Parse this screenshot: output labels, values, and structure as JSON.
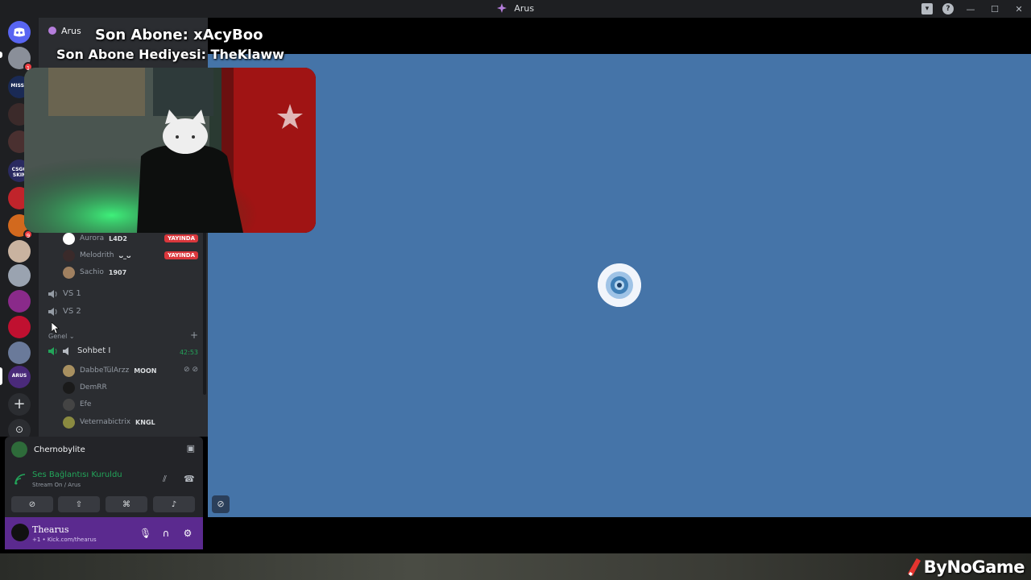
{
  "window": {
    "title": "Arus"
  },
  "overlay": {
    "last_sub": "Son Abone: xAcyBoo",
    "last_gift": "Son Abone Hediyesi: TheKlaww"
  },
  "sidebar": {
    "server_name": "Arus",
    "members_live": [
      {
        "name": "Aurora",
        "tag": "L4D2",
        "live": "YAYINDA"
      },
      {
        "name": "Melodrith",
        "tag": "ᴗ_ᴗ",
        "live": "YAYINDA"
      },
      {
        "name": "Sachio",
        "tag": "1907",
        "live": ""
      }
    ],
    "voice_channels": [
      {
        "name": "VS 1"
      },
      {
        "name": "VS 2"
      }
    ],
    "category": "Genel",
    "active_channel": {
      "name": "Sohbet I",
      "timer": "42:53"
    },
    "members": [
      {
        "name": "DabbeTülArzz",
        "tag": "MOON"
      },
      {
        "name": "DemRR",
        "tag": ""
      },
      {
        "name": "Efe",
        "tag": ""
      },
      {
        "name": "Veternabictrix",
        "tag": "KNGL"
      }
    ]
  },
  "voice_panel": {
    "activity": "Chernobylite",
    "status": "Ses Bağlantısı Kuruldu",
    "sub": "Stream On / Arus"
  },
  "user_panel": {
    "name": "Thearus",
    "sub": "+1 • Kick.com/thearus"
  },
  "servers": [
    {
      "badge": "1"
    },
    {
      "badge": ""
    },
    {
      "badge": ""
    },
    {
      "badge": ""
    },
    {
      "badge": ""
    },
    {
      "badge": ""
    },
    {
      "badge": "9"
    }
  ],
  "server_labels": {
    "missa": "MISSA",
    "csgo": "CSGO SKIN",
    "arus": "ARUS"
  },
  "watermark": "ByNoGame",
  "colors": {
    "stage": "#4574a8",
    "live_badge": "#da373c",
    "connected_green": "#23a55a",
    "user_panel": "#5b2a8f"
  }
}
